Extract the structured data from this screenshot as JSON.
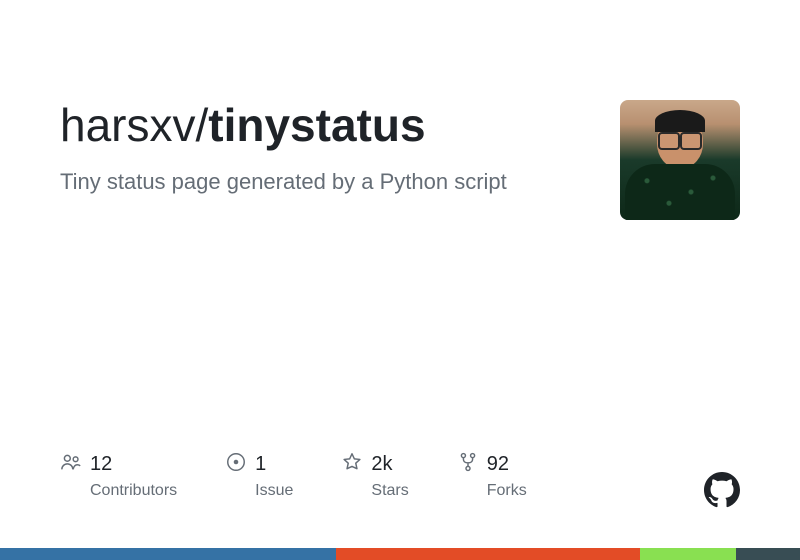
{
  "repo": {
    "owner": "harsxv",
    "name": "tinystatus",
    "description": "Tiny status page generated by a Python script"
  },
  "stats": {
    "contributors": {
      "value": "12",
      "label": "Contributors"
    },
    "issues": {
      "value": "1",
      "label": "Issue"
    },
    "stars": {
      "value": "2k",
      "label": "Stars"
    },
    "forks": {
      "value": "92",
      "label": "Forks"
    }
  },
  "language_bar": [
    {
      "color": "#3572A5",
      "percent": 42
    },
    {
      "color": "#e34c26",
      "percent": 38
    },
    {
      "color": "#89e051",
      "percent": 12
    },
    {
      "color": "#384d54",
      "percent": 8
    }
  ]
}
